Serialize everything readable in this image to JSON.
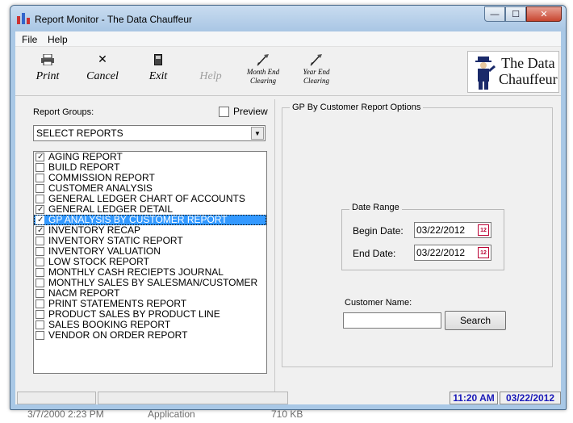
{
  "desktop_row": {
    "date": "3/7/2000 2:23 PM",
    "type": "Application",
    "size": "710 KB"
  },
  "window": {
    "title": "Report Monitor - The Data Chauffeur",
    "min_glyph": "—",
    "max_glyph": "☐",
    "close_glyph": "✕"
  },
  "menu": {
    "file": "File",
    "help": "Help"
  },
  "toolbar": {
    "print": "Print",
    "cancel": "Cancel",
    "exit": "Exit",
    "help": "Help",
    "month_end_1": "Month End",
    "month_end_2": "Clearing",
    "year_end_1": "Year End",
    "year_end_2": "Clearing"
  },
  "logo": {
    "line1": "The Data",
    "line2": "Chauffeur"
  },
  "left": {
    "groups_label": "Report Groups:",
    "preview_label": "Preview",
    "preview_checked": false,
    "combo_value": "SELECT REPORTS",
    "reports": [
      {
        "label": "AGING REPORT",
        "checked": true
      },
      {
        "label": "BUILD REPORT",
        "checked": false
      },
      {
        "label": "COMMISSION REPORT",
        "checked": false
      },
      {
        "label": "CUSTOMER ANALYSIS",
        "checked": false
      },
      {
        "label": "GENERAL LEDGER CHART OF ACCOUNTS",
        "checked": false
      },
      {
        "label": "GENERAL LEDGER DETAIL",
        "checked": true
      },
      {
        "label": "GP ANALYSIS BY CUSTOMER REPORT",
        "checked": true,
        "selected": true
      },
      {
        "label": "INVENTORY RECAP",
        "checked": true
      },
      {
        "label": "INVENTORY STATIC REPORT",
        "checked": false
      },
      {
        "label": "INVENTORY VALUATION",
        "checked": false
      },
      {
        "label": "LOW STOCK REPORT",
        "checked": false
      },
      {
        "label": "MONTHLY CASH RECIEPTS JOURNAL",
        "checked": false
      },
      {
        "label": "MONTHLY SALES BY SALESMAN/CUSTOMER",
        "checked": false
      },
      {
        "label": "NACM REPORT",
        "checked": false
      },
      {
        "label": "PRINT STATEMENTS REPORT",
        "checked": false
      },
      {
        "label": "PRODUCT SALES BY PRODUCT LINE",
        "checked": false
      },
      {
        "label": "SALES BOOKING REPORT",
        "checked": false
      },
      {
        "label": "VENDOR ON ORDER REPORT",
        "checked": false
      }
    ]
  },
  "right": {
    "options_title": "GP By Customer Report Options",
    "date_range_title": "Date Range",
    "begin_label": "Begin Date:",
    "begin_value": "03/22/2012",
    "end_label": "End Date:",
    "end_value": "03/22/2012",
    "calendar_glyph": "12",
    "customer_label": "Customer Name:",
    "customer_value": "",
    "search_label": "Search"
  },
  "status": {
    "time": "11:20 AM",
    "date": "03/22/2012"
  },
  "colors": {
    "selection": "#3399ff",
    "status_text": "#1a1ab8"
  }
}
